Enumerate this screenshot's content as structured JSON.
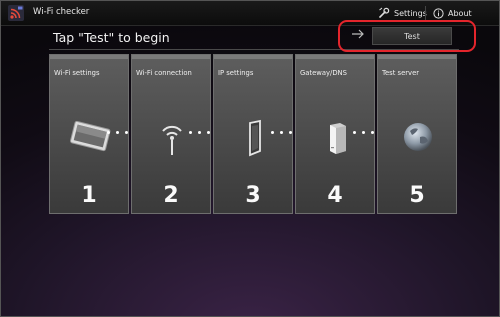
{
  "app": {
    "title": "Wi-Fi checker"
  },
  "actionbar": {
    "settings_label": "Settings",
    "about_label": "About"
  },
  "main": {
    "headline": "Tap \"Test\" to begin",
    "test_button_label": "Test"
  },
  "steps": [
    {
      "label": "Wi-Fi settings",
      "number": "1",
      "icon": "tablet-icon"
    },
    {
      "label": "Wi-Fi connection",
      "number": "2",
      "icon": "wifi-antenna-icon"
    },
    {
      "label": "IP settings",
      "number": "3",
      "icon": "ip-panel-icon"
    },
    {
      "label": "Gateway/DNS",
      "number": "4",
      "icon": "gateway-router-icon"
    },
    {
      "label": "Test server",
      "number": "5",
      "icon": "globe-icon"
    }
  ],
  "colors": {
    "highlight": "#e4252c",
    "card_top": "#5e5e5e",
    "background": "#1f1528"
  }
}
